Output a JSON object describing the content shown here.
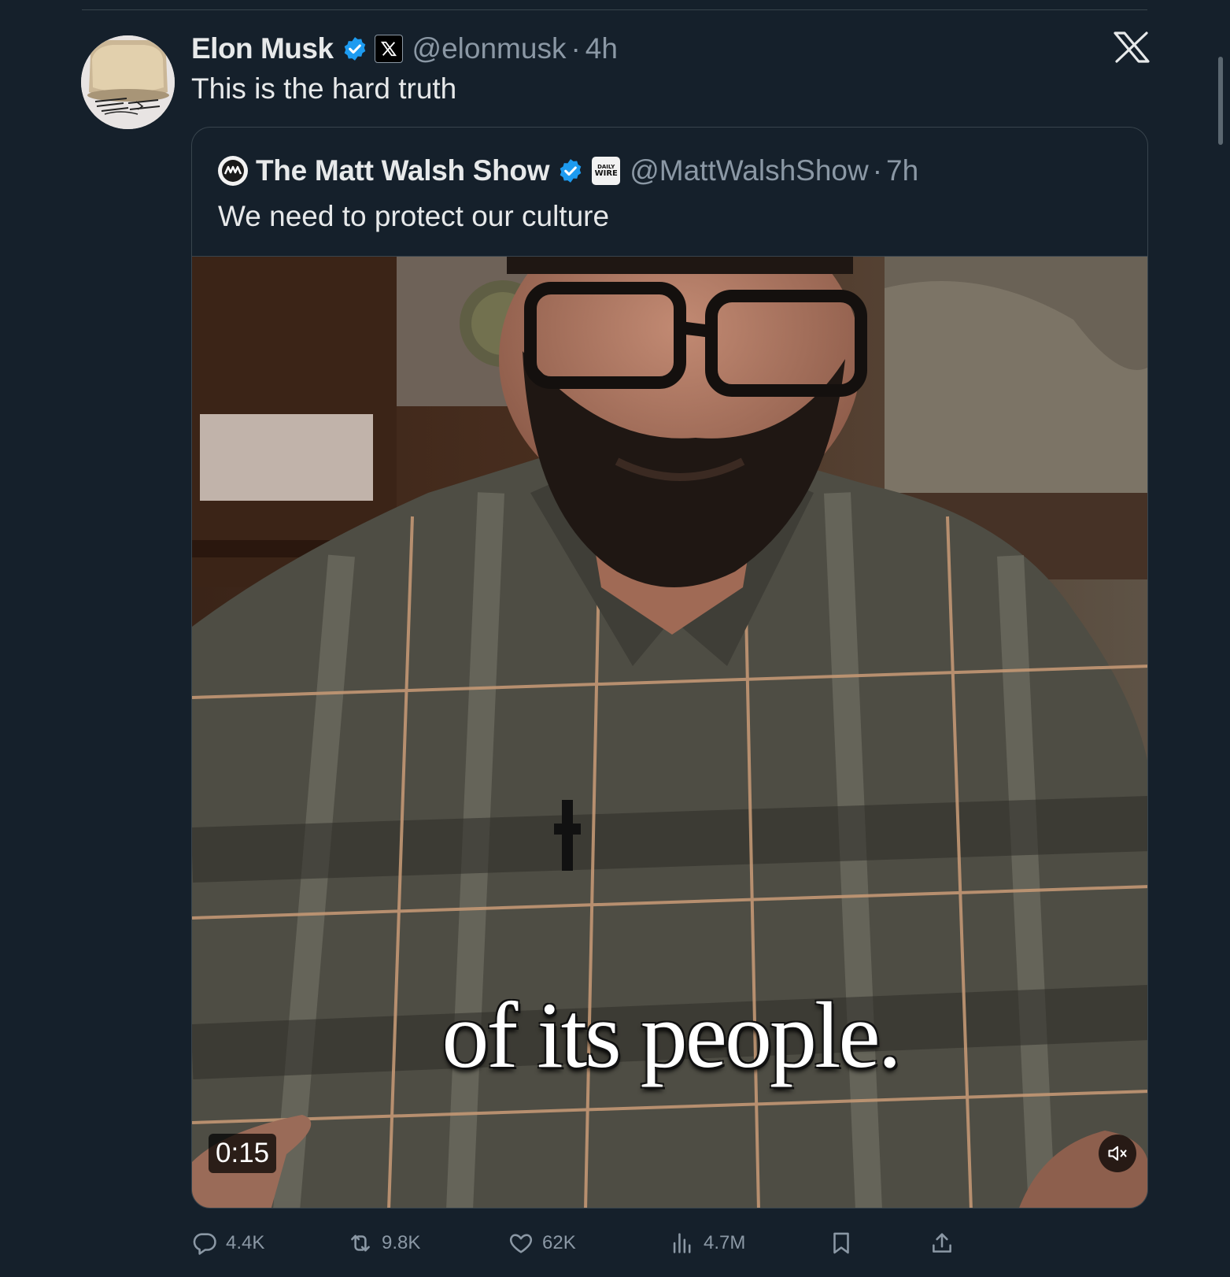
{
  "tweet": {
    "author_name": "Elon Musk",
    "handle": "@elonmusk",
    "separator": "·",
    "time": "4h",
    "text": "This is the hard truth",
    "avatar_icon": "avatar-image",
    "affiliation_icon": "x-logo-icon"
  },
  "quoted_tweet": {
    "author_name": "The Matt Walsh Show",
    "handle": "@MattWalshShow",
    "separator": "·",
    "time": "7h",
    "text": "We need to protect our culture",
    "affiliation_badge": {
      "top": "DAILY",
      "bottom": "WIRE"
    },
    "video": {
      "caption": "of its people.",
      "duration": "0:15",
      "muted": true
    }
  },
  "actions": {
    "replies": "4.4K",
    "reposts": "9.8K",
    "likes": "62K",
    "views": "4.7M"
  },
  "colors": {
    "background": "#15202b",
    "text": "#e7e9ea",
    "secondary_text": "#8b98a5",
    "border": "#38444d",
    "verified": "#1d9bf0"
  }
}
